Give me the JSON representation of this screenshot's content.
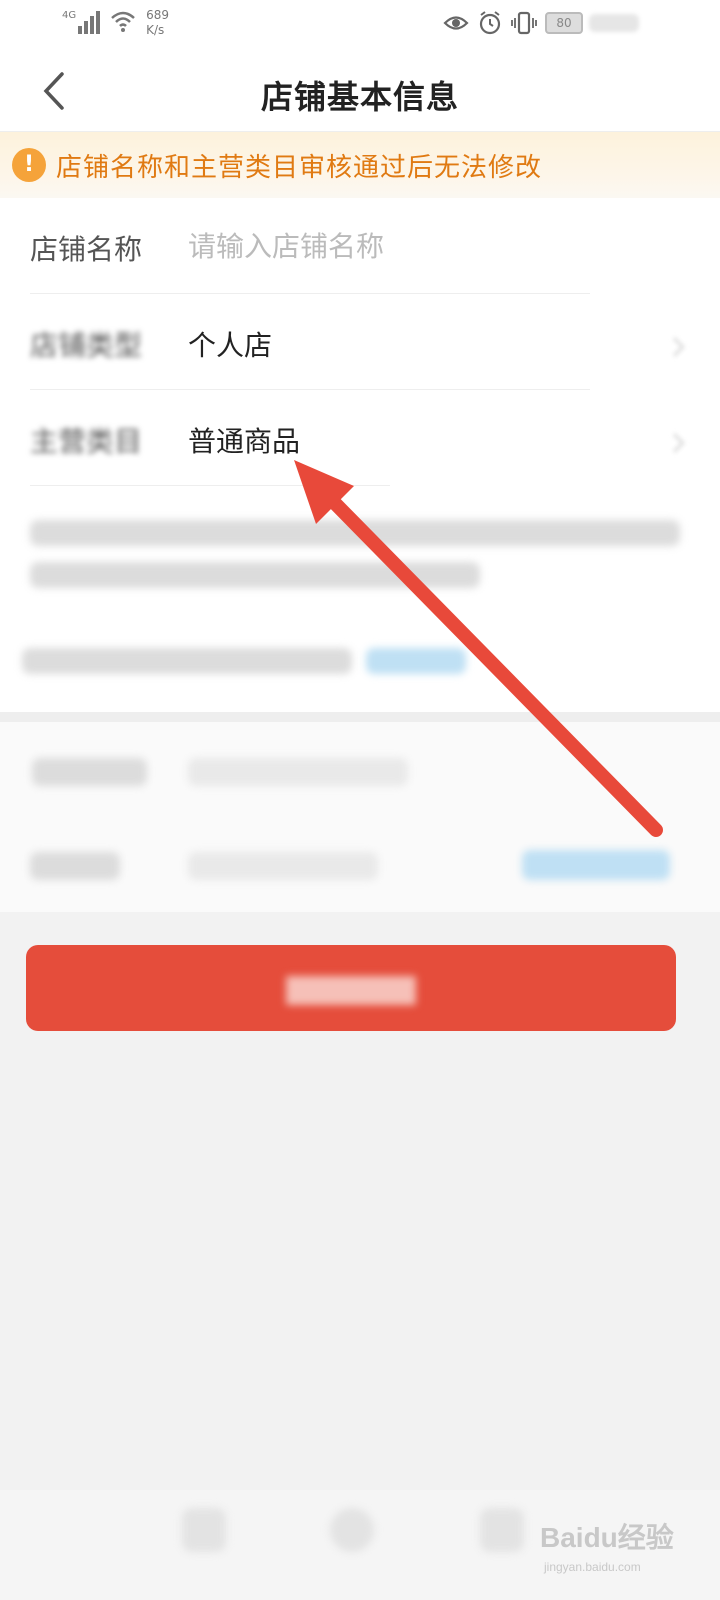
{
  "status_bar": {
    "network": "4G",
    "speed_value": "689",
    "speed_unit": "K/s",
    "battery": "80"
  },
  "nav": {
    "title": "店铺基本信息"
  },
  "notice": {
    "icon_glyph": "!",
    "text": "店铺名称和主营类目审核通过后无法修改"
  },
  "form": {
    "store_name": {
      "label": "店铺名称",
      "placeholder": "请输入店铺名称",
      "value": ""
    },
    "store_type": {
      "label": "店铺类型",
      "value": "个人店"
    },
    "main_category": {
      "label": "主营类目",
      "value": "普通商品"
    }
  },
  "watermark": {
    "brand": "Baidu经验",
    "site": "jingyan.baidu.com"
  },
  "colors": {
    "accent_red": "#e54d3b",
    "notice_orange": "#e07a12",
    "arrow_red": "#e8493a"
  },
  "icons": {
    "back": "chevron-left-icon",
    "notice": "exclamation-icon",
    "eye": "eye-icon",
    "alarm": "alarm-icon",
    "vibrate": "vibrate-icon"
  }
}
